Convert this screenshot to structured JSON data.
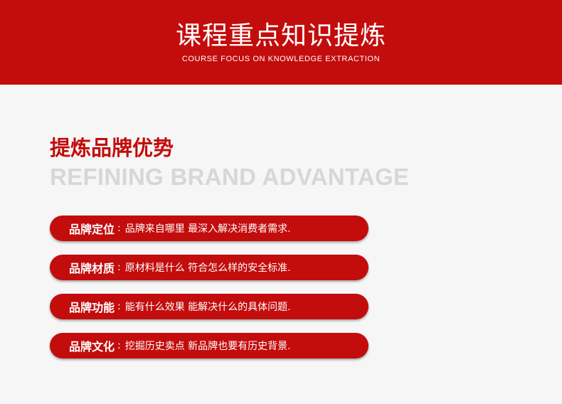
{
  "banner": {
    "title": "课程重点知识提炼",
    "subtitle": "COURSE FOCUS ON KNOWLEDGE EXTRACTION"
  },
  "section": {
    "title": "提炼品牌优势",
    "subtitle": "REFINING BRAND ADVANTAGE"
  },
  "items": [
    {
      "label": "品牌定位",
      "sep": ":",
      "text": "品牌来自哪里  最深入解决消费者需求."
    },
    {
      "label": "品牌材质",
      "sep": ":",
      "text": "原材料是什么   符合怎么样的安全标准."
    },
    {
      "label": "品牌功能",
      "sep": ":",
      "text": "能有什么效果   能解决什么的具体问题."
    },
    {
      "label": "品牌文化",
      "sep": ":",
      "text": "挖掘历史卖点   新品牌也要有历史背景."
    }
  ],
  "colors": {
    "brand_red": "#c30c0c",
    "background": "#f6f6f6",
    "subtitle_gray": "#d7d7d7"
  }
}
